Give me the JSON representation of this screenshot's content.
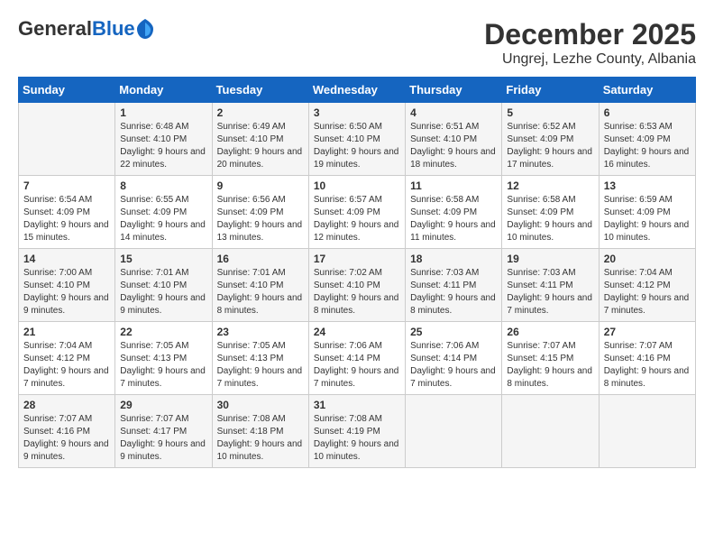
{
  "logo": {
    "general": "General",
    "blue": "Blue"
  },
  "header": {
    "month_title": "December 2025",
    "location": "Ungrej, Lezhe County, Albania"
  },
  "weekdays": [
    "Sunday",
    "Monday",
    "Tuesday",
    "Wednesday",
    "Thursday",
    "Friday",
    "Saturday"
  ],
  "weeks": [
    [
      {
        "day": "",
        "sunrise": "",
        "sunset": "",
        "daylight": ""
      },
      {
        "day": "1",
        "sunrise": "Sunrise: 6:48 AM",
        "sunset": "Sunset: 4:10 PM",
        "daylight": "Daylight: 9 hours and 22 minutes."
      },
      {
        "day": "2",
        "sunrise": "Sunrise: 6:49 AM",
        "sunset": "Sunset: 4:10 PM",
        "daylight": "Daylight: 9 hours and 20 minutes."
      },
      {
        "day": "3",
        "sunrise": "Sunrise: 6:50 AM",
        "sunset": "Sunset: 4:10 PM",
        "daylight": "Daylight: 9 hours and 19 minutes."
      },
      {
        "day": "4",
        "sunrise": "Sunrise: 6:51 AM",
        "sunset": "Sunset: 4:10 PM",
        "daylight": "Daylight: 9 hours and 18 minutes."
      },
      {
        "day": "5",
        "sunrise": "Sunrise: 6:52 AM",
        "sunset": "Sunset: 4:09 PM",
        "daylight": "Daylight: 9 hours and 17 minutes."
      },
      {
        "day": "6",
        "sunrise": "Sunrise: 6:53 AM",
        "sunset": "Sunset: 4:09 PM",
        "daylight": "Daylight: 9 hours and 16 minutes."
      }
    ],
    [
      {
        "day": "7",
        "sunrise": "Sunrise: 6:54 AM",
        "sunset": "Sunset: 4:09 PM",
        "daylight": "Daylight: 9 hours and 15 minutes."
      },
      {
        "day": "8",
        "sunrise": "Sunrise: 6:55 AM",
        "sunset": "Sunset: 4:09 PM",
        "daylight": "Daylight: 9 hours and 14 minutes."
      },
      {
        "day": "9",
        "sunrise": "Sunrise: 6:56 AM",
        "sunset": "Sunset: 4:09 PM",
        "daylight": "Daylight: 9 hours and 13 minutes."
      },
      {
        "day": "10",
        "sunrise": "Sunrise: 6:57 AM",
        "sunset": "Sunset: 4:09 PM",
        "daylight": "Daylight: 9 hours and 12 minutes."
      },
      {
        "day": "11",
        "sunrise": "Sunrise: 6:58 AM",
        "sunset": "Sunset: 4:09 PM",
        "daylight": "Daylight: 9 hours and 11 minutes."
      },
      {
        "day": "12",
        "sunrise": "Sunrise: 6:58 AM",
        "sunset": "Sunset: 4:09 PM",
        "daylight": "Daylight: 9 hours and 10 minutes."
      },
      {
        "day": "13",
        "sunrise": "Sunrise: 6:59 AM",
        "sunset": "Sunset: 4:09 PM",
        "daylight": "Daylight: 9 hours and 10 minutes."
      }
    ],
    [
      {
        "day": "14",
        "sunrise": "Sunrise: 7:00 AM",
        "sunset": "Sunset: 4:10 PM",
        "daylight": "Daylight: 9 hours and 9 minutes."
      },
      {
        "day": "15",
        "sunrise": "Sunrise: 7:01 AM",
        "sunset": "Sunset: 4:10 PM",
        "daylight": "Daylight: 9 hours and 9 minutes."
      },
      {
        "day": "16",
        "sunrise": "Sunrise: 7:01 AM",
        "sunset": "Sunset: 4:10 PM",
        "daylight": "Daylight: 9 hours and 8 minutes."
      },
      {
        "day": "17",
        "sunrise": "Sunrise: 7:02 AM",
        "sunset": "Sunset: 4:10 PM",
        "daylight": "Daylight: 9 hours and 8 minutes."
      },
      {
        "day": "18",
        "sunrise": "Sunrise: 7:03 AM",
        "sunset": "Sunset: 4:11 PM",
        "daylight": "Daylight: 9 hours and 8 minutes."
      },
      {
        "day": "19",
        "sunrise": "Sunrise: 7:03 AM",
        "sunset": "Sunset: 4:11 PM",
        "daylight": "Daylight: 9 hours and 7 minutes."
      },
      {
        "day": "20",
        "sunrise": "Sunrise: 7:04 AM",
        "sunset": "Sunset: 4:12 PM",
        "daylight": "Daylight: 9 hours and 7 minutes."
      }
    ],
    [
      {
        "day": "21",
        "sunrise": "Sunrise: 7:04 AM",
        "sunset": "Sunset: 4:12 PM",
        "daylight": "Daylight: 9 hours and 7 minutes."
      },
      {
        "day": "22",
        "sunrise": "Sunrise: 7:05 AM",
        "sunset": "Sunset: 4:13 PM",
        "daylight": "Daylight: 9 hours and 7 minutes."
      },
      {
        "day": "23",
        "sunrise": "Sunrise: 7:05 AM",
        "sunset": "Sunset: 4:13 PM",
        "daylight": "Daylight: 9 hours and 7 minutes."
      },
      {
        "day": "24",
        "sunrise": "Sunrise: 7:06 AM",
        "sunset": "Sunset: 4:14 PM",
        "daylight": "Daylight: 9 hours and 7 minutes."
      },
      {
        "day": "25",
        "sunrise": "Sunrise: 7:06 AM",
        "sunset": "Sunset: 4:14 PM",
        "daylight": "Daylight: 9 hours and 7 minutes."
      },
      {
        "day": "26",
        "sunrise": "Sunrise: 7:07 AM",
        "sunset": "Sunset: 4:15 PM",
        "daylight": "Daylight: 9 hours and 8 minutes."
      },
      {
        "day": "27",
        "sunrise": "Sunrise: 7:07 AM",
        "sunset": "Sunset: 4:16 PM",
        "daylight": "Daylight: 9 hours and 8 minutes."
      }
    ],
    [
      {
        "day": "28",
        "sunrise": "Sunrise: 7:07 AM",
        "sunset": "Sunset: 4:16 PM",
        "daylight": "Daylight: 9 hours and 9 minutes."
      },
      {
        "day": "29",
        "sunrise": "Sunrise: 7:07 AM",
        "sunset": "Sunset: 4:17 PM",
        "daylight": "Daylight: 9 hours and 9 minutes."
      },
      {
        "day": "30",
        "sunrise": "Sunrise: 7:08 AM",
        "sunset": "Sunset: 4:18 PM",
        "daylight": "Daylight: 9 hours and 10 minutes."
      },
      {
        "day": "31",
        "sunrise": "Sunrise: 7:08 AM",
        "sunset": "Sunset: 4:19 PM",
        "daylight": "Daylight: 9 hours and 10 minutes."
      },
      {
        "day": "",
        "sunrise": "",
        "sunset": "",
        "daylight": ""
      },
      {
        "day": "",
        "sunrise": "",
        "sunset": "",
        "daylight": ""
      },
      {
        "day": "",
        "sunrise": "",
        "sunset": "",
        "daylight": ""
      }
    ]
  ]
}
